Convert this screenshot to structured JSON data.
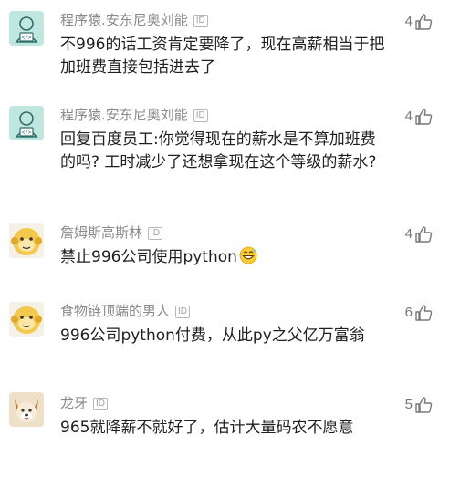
{
  "comments": [
    {
      "name": "程序猿.安东尼奥刘能",
      "badge": "ID",
      "text": "不996的话工资肯定要降了，现在高薪相当于把加班费直接包括进去了",
      "likes": "4",
      "avatar": "programmer-avatar"
    },
    {
      "name": "程序猿.安东尼奥刘能",
      "badge": "ID",
      "text": "回复百度员工:你觉得现在的薪水是不算加班费的吗? 工时减少了还想拿现在这个等级的薪水?",
      "likes": "4",
      "avatar": "programmer-avatar"
    },
    {
      "name": "詹姆斯高斯林",
      "badge": "ID",
      "text": "禁止996公司使用python",
      "likes": "4",
      "avatar": "monkey-avatar",
      "emoji": "grinning-sweat-emoji"
    },
    {
      "name": "食物链顶端的男人",
      "badge": "ID",
      "text": "996公司python付费，从此py之父亿万富翁",
      "likes": "6",
      "avatar": "monkey-avatar"
    },
    {
      "name": "龙牙",
      "badge": "ID",
      "text": "965就降薪不就好了，估计大量码农不愿意",
      "likes": "5",
      "avatar": "dog-avatar"
    }
  ],
  "colors": {
    "name": "#8a8a8a",
    "text": "#1f1f1f",
    "like": "#777777",
    "programmer_bg": "#bfe6df",
    "monkey_bg": "#f2c94c",
    "dog_bg": "#efe0c8"
  }
}
